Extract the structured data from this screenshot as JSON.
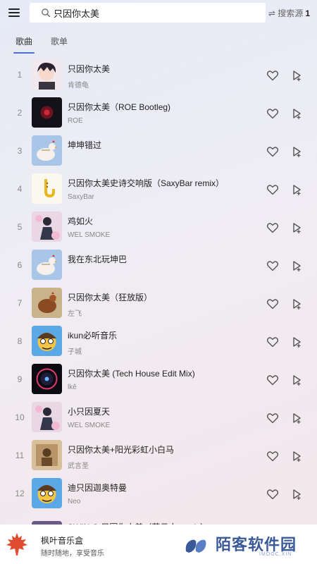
{
  "search": {
    "value": "只因你太美",
    "placeholder": ""
  },
  "source": {
    "label": "⇌ 搜索源",
    "number": "1"
  },
  "tabs": [
    {
      "label": "歌曲"
    },
    {
      "label": "歌单"
    }
  ],
  "songs": [
    {
      "index": "1",
      "title": "只因你太美",
      "artist": "肯德龟",
      "cover": "anime-boy"
    },
    {
      "index": "2",
      "title": "只因你太美（ROE Bootleg)",
      "artist": "ROE",
      "cover": "dark-red"
    },
    {
      "index": "3",
      "title": "坤坤错过",
      "artist": "",
      "cover": "chicken"
    },
    {
      "index": "4",
      "title": "只因你太美史诗交响版（SaxyBar remix）",
      "artist": "SaxyBar",
      "cover": "saxophone"
    },
    {
      "index": "5",
      "title": "鸡如火",
      "artist": "WEL SMOKE",
      "cover": "pink-dancer"
    },
    {
      "index": "6",
      "title": "我在东北玩坤巴",
      "artist": "",
      "cover": "chicken"
    },
    {
      "index": "7",
      "title": "只因你太美（狂放版）",
      "artist": "左飞",
      "cover": "rooster"
    },
    {
      "index": "8",
      "title": "ikun必听音乐",
      "artist": "子城",
      "cover": "cartoon-face"
    },
    {
      "index": "9",
      "title": "只因你太美 (Tech House Edit Mix)",
      "artist": "lkê",
      "cover": "dark-circle"
    },
    {
      "index": "10",
      "title": "小只因夏天",
      "artist": "WEL SMOKE",
      "cover": "pink-dancer"
    },
    {
      "index": "11",
      "title": "只因你太美+阳光彩虹小白马",
      "artist": "武言圣",
      "cover": "sepia"
    },
    {
      "index": "12",
      "title": "迪只因迦奥特曼",
      "artist": "Neo",
      "cover": "cartoon-face"
    }
  ],
  "partial_song": {
    "title": "SWIN-S-只因你太美（莲云大 remix）"
  },
  "banner": {
    "app_name": "枫叶音乐盒",
    "slogan": "随时随地，享受音乐",
    "watermark": "陌客软件园",
    "watermark_sub": "IMOOC.XIN"
  },
  "colors": {
    "accent": "#4a6fd1",
    "heart": "#555555",
    "logo_red": "#e04b2f"
  },
  "icons": [
    "menu-icon",
    "search-icon",
    "swap-icon",
    "heart-icon",
    "next-play-icon",
    "maple-leaf-icon"
  ]
}
